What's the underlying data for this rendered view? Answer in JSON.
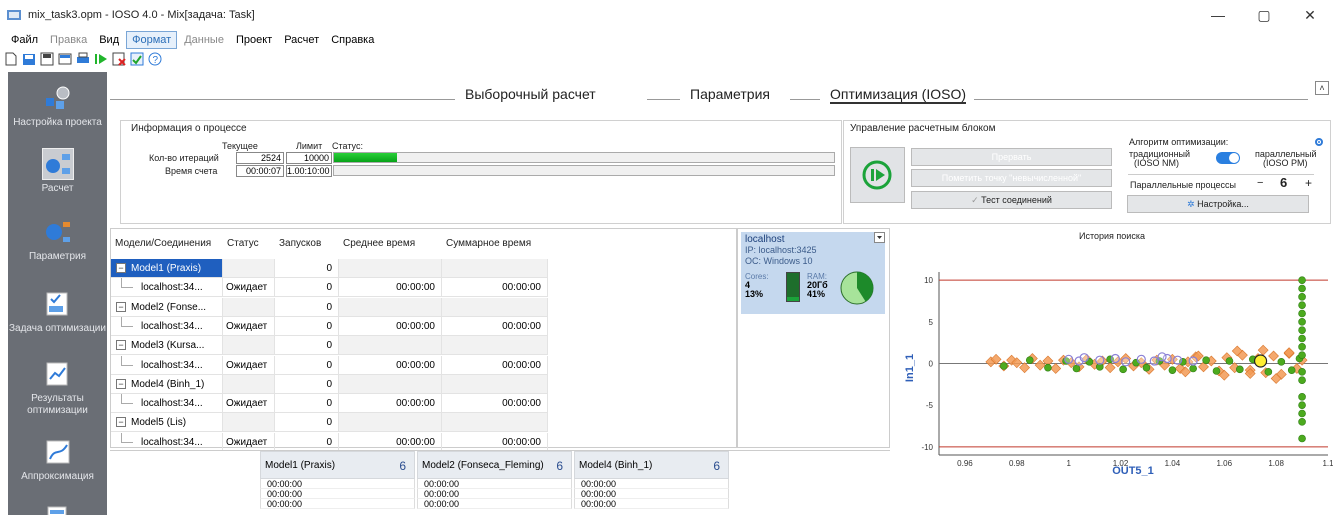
{
  "window": {
    "title": "mix_task3.opm - IOSO 4.0 - Mix[задача: Task]",
    "minimize": "—",
    "maximize": "▢",
    "close": "✕"
  },
  "menu": [
    {
      "label": "Файл",
      "state": "normal"
    },
    {
      "label": "Правка",
      "state": "disabled"
    },
    {
      "label": "Вид",
      "state": "normal"
    },
    {
      "label": "Формат",
      "state": "active"
    },
    {
      "label": "Данные",
      "state": "disabled"
    },
    {
      "label": "Проект",
      "state": "normal"
    },
    {
      "label": "Расчет",
      "state": "normal"
    },
    {
      "label": "Справка",
      "state": "normal"
    }
  ],
  "sidebar": [
    {
      "label": "Настройка проекта",
      "icon": "project-settings-icon"
    },
    {
      "label": "Расчет",
      "icon": "calculation-icon",
      "active": true
    },
    {
      "label": "Параметрия",
      "icon": "parametry-icon"
    },
    {
      "label": "Задача оптимизации",
      "icon": "optimization-task-icon"
    },
    {
      "label": "Результаты оптимизации",
      "icon": "optimization-results-icon"
    },
    {
      "label": "Аппроксимация",
      "icon": "approximation-icon"
    }
  ],
  "tabs": [
    "Выборочный расчет",
    "Параметрия",
    "Оптимизация (IOSO)"
  ],
  "process": {
    "title": "Информация о процессе",
    "col_current": "Текущее",
    "col_limit": "Лимит",
    "col_status": "Статус:",
    "iter_label": "Кол-во итераций",
    "iter_current": "2524",
    "iter_limit": "10000",
    "iter_progress": 0.252,
    "time_label": "Время счета",
    "time_current": "00:00:07",
    "time_limit": "1.00:10:00",
    "time_progress": 0.0
  },
  "control": {
    "title": "Управление расчетным блоком",
    "interrupt": "Прервать",
    "mark_unused": "Пометить точку \"невычисленной\"",
    "test": "Тест соединений",
    "algorithm_label": "Алгоритм оптимизации:",
    "traditional": "традиционный",
    "traditional_sub": "(IOSO NM)",
    "parallel": "параллельный",
    "parallel_sub": "(IOSO PM)",
    "parallel_processes": "Параллельные процессы",
    "minus": "−",
    "count": "6",
    "plus": "+",
    "settings": "Настройка..."
  },
  "table": {
    "headers": [
      "Модели/Соединения",
      "Статус",
      "Запусков",
      "Среднее время",
      "Суммарное время"
    ],
    "rows": [
      {
        "type": "model",
        "name": "Model1 (Praxis)",
        "status": "",
        "runs": "0",
        "avg": "",
        "total": "",
        "selected": true
      },
      {
        "type": "conn",
        "name": "localhost:34...",
        "status": "Ожидает",
        "runs": "0",
        "avg": "00:00:00",
        "total": "00:00:00"
      },
      {
        "type": "model",
        "name": "Model2 (Fonse...",
        "status": "",
        "runs": "0",
        "avg": "",
        "total": ""
      },
      {
        "type": "conn",
        "name": "localhost:34...",
        "status": "Ожидает",
        "runs": "0",
        "avg": "00:00:00",
        "total": "00:00:00"
      },
      {
        "type": "model",
        "name": "Model3 (Kursa...",
        "status": "",
        "runs": "0",
        "avg": "",
        "total": ""
      },
      {
        "type": "conn",
        "name": "localhost:34...",
        "status": "Ожидает",
        "runs": "0",
        "avg": "00:00:00",
        "total": "00:00:00"
      },
      {
        "type": "model",
        "name": "Model4 (Binh_1)",
        "status": "",
        "runs": "0",
        "avg": "",
        "total": ""
      },
      {
        "type": "conn",
        "name": "localhost:34...",
        "status": "Ожидает",
        "runs": "0",
        "avg": "00:00:00",
        "total": "00:00:00"
      },
      {
        "type": "model",
        "name": "Model5 (Lis)",
        "status": "",
        "runs": "0",
        "avg": "",
        "total": ""
      },
      {
        "type": "conn",
        "name": "localhost:34...",
        "status": "Ожидает",
        "runs": "0",
        "avg": "00:00:00",
        "total": "00:00:00"
      }
    ]
  },
  "host": {
    "name": "localhost",
    "ip": "IP: localhost:3425",
    "os": "ОС: Windows 10",
    "cores_label": "Cores:",
    "cores": "4",
    "cores_pct": "13%",
    "ram_label": "RAM:",
    "ram": "20Гб",
    "ram_pct": "41%",
    "cpu_usage": 0.13,
    "ram_usage": 0.41
  },
  "bottom_models": [
    {
      "name": "Model1 (Praxis)",
      "count": "6",
      "values": [
        "00:00:00",
        "00:00:00",
        "00:00:00"
      ]
    },
    {
      "name": "Model2 (Fonseca_Fleming)",
      "count": "6",
      "values": [
        "00:00:00",
        "00:00:00",
        "00:00:00"
      ]
    },
    {
      "name": "Model4 (Binh_1)",
      "count": "6",
      "values": [
        "00:00:00",
        "00:00:00",
        "00:00:00"
      ]
    }
  ],
  "colors": {
    "sidebar": "#6a6e75",
    "selection": "#1f5fbf",
    "progress": "#13b526",
    "hostcard": "#c5d8ee"
  },
  "chart_data": {
    "type": "scatter",
    "title": "История поиска",
    "xlabel": "OUT5_1",
    "ylabel": "In1_1",
    "xlim": [
      0.95,
      1.1
    ],
    "ylim": [
      -10.5,
      10.5
    ],
    "xticks": [
      "0.96",
      "0.98",
      "1",
      "1.02",
      "1.04",
      "1.06",
      "1.08",
      "1.1"
    ],
    "yticks": [
      "10",
      "5",
      "0",
      "-5",
      "-10"
    ],
    "hlines": [
      10,
      0,
      -10
    ],
    "highlight": {
      "x": 1.074,
      "y": 0.3
    },
    "series": [
      {
        "color": "#f29a55",
        "marker": "diamond",
        "x": [
          0.97,
          0.972,
          0.975,
          0.978,
          0.98,
          0.983,
          0.986,
          0.989,
          0.992,
          0.995,
          0.998,
          1.001,
          1.004,
          1.007,
          1.01,
          1.013,
          1.016,
          1.019,
          1.022,
          1.025,
          1.028,
          1.031,
          1.034,
          1.037,
          1.04,
          1.043,
          1.046,
          1.049,
          1.052,
          1.055,
          1.058,
          1.061,
          1.064,
          1.067,
          1.07,
          1.073,
          1.076,
          1.079,
          1.082,
          1.085,
          1.088,
          1.09,
          1.06,
          1.065,
          1.07,
          1.075,
          1.08,
          1.085,
          1.05,
          1.045
        ],
        "y": [
          0.2,
          0.5,
          -0.3,
          0.4,
          0.1,
          -0.5,
          0.6,
          -0.2,
          0.3,
          -0.6,
          0.4,
          0.1,
          -0.4,
          0.5,
          -0.1,
          0.3,
          -0.5,
          0.2,
          0.6,
          -0.3,
          0.1,
          -0.7,
          0.4,
          -0.2,
          0.5,
          -0.6,
          0.2,
          0.8,
          -0.4,
          0.3,
          -0.9,
          0.7,
          -0.5,
          1.0,
          -0.8,
          0.6,
          -1.1,
          0.9,
          -1.3,
          1.2,
          -0.6,
          0.4,
          -1.4,
          1.5,
          -1.2,
          1.6,
          -1.8,
          1.3,
          0.9,
          -1.0
        ]
      },
      {
        "color": "#4caa1e",
        "marker": "circle",
        "x": [
          0.975,
          0.985,
          0.992,
          0.999,
          1.003,
          1.008,
          1.012,
          1.016,
          1.021,
          1.026,
          1.03,
          1.035,
          1.04,
          1.044,
          1.048,
          1.053,
          1.057,
          1.062,
          1.066,
          1.071,
          1.077,
          1.082,
          1.086,
          1.089,
          1.09,
          1.09,
          1.09,
          1.09,
          1.09,
          1.09,
          1.09,
          1.09,
          1.09,
          1.09,
          1.09,
          1.09,
          1.09,
          1.09,
          1.09,
          1.09,
          1.09
        ],
        "y": [
          -0.3,
          0.4,
          -0.5,
          0.3,
          -0.6,
          0.2,
          -0.4,
          0.5,
          -0.7,
          0.1,
          -0.5,
          0.3,
          -0.8,
          0.2,
          -0.6,
          0.4,
          -0.9,
          0.3,
          -0.7,
          0.5,
          -1.0,
          0.2,
          -0.8,
          0.6,
          10,
          9,
          8,
          7,
          6,
          5,
          4,
          3,
          2,
          1,
          -1,
          -2,
          -4,
          -5,
          -6,
          -7,
          -9
        ]
      },
      {
        "color": "#8a7fd6",
        "marker": "ring",
        "x": [
          1.0,
          1.004,
          1.006,
          1.012,
          1.018,
          1.022,
          1.028,
          1.033,
          1.038,
          1.042,
          1.036,
          1.048
        ],
        "y": [
          0.5,
          0.3,
          0.7,
          0.4,
          0.6,
          0.2,
          0.5,
          0.3,
          0.6,
          0.4,
          0.8,
          0.3
        ]
      }
    ]
  }
}
